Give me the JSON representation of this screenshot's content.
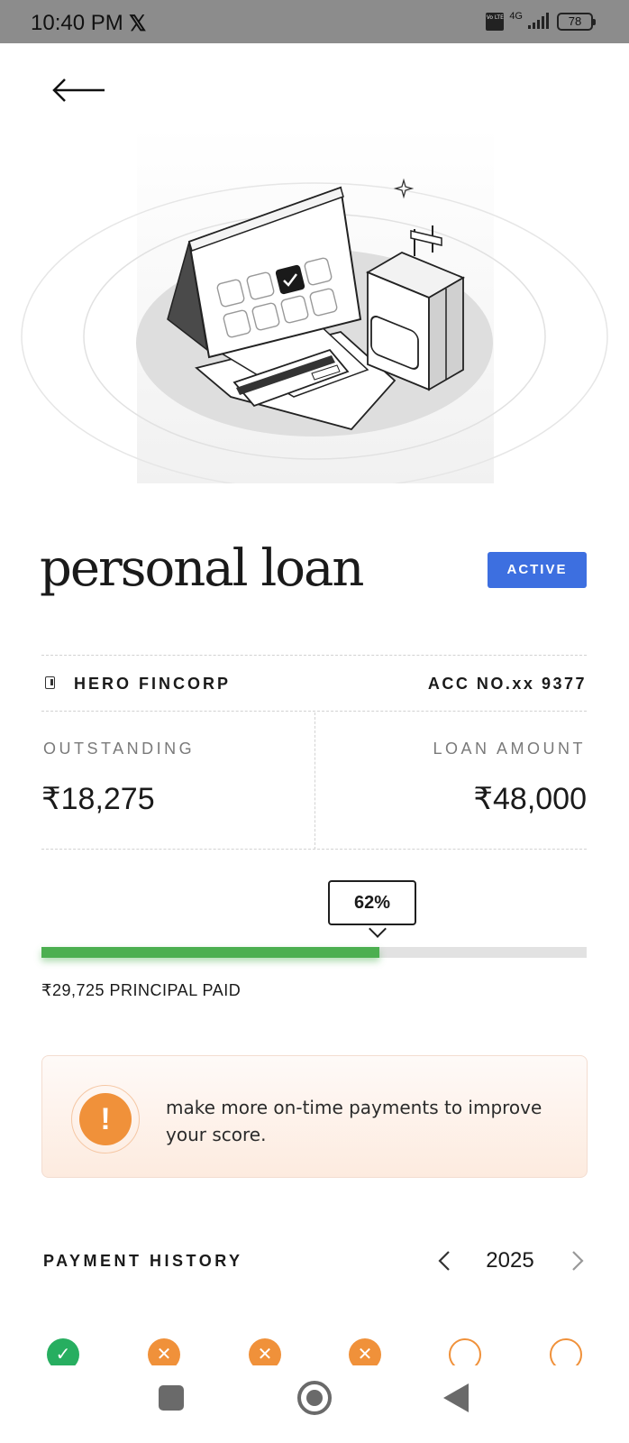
{
  "status_bar": {
    "time": "10:40 PM",
    "x_logo": "𝕏",
    "volte": "Vo LTE",
    "network": "4G",
    "battery": "78"
  },
  "loan": {
    "title": "personal loan",
    "status": "ACTIVE",
    "lender": "HERO FINCORP",
    "account": "ACC NO.xx 9377",
    "outstanding_label": "OUTSTANDING",
    "outstanding_value": "₹18,275",
    "loan_amount_label": "LOAN AMOUNT",
    "loan_amount_value": "₹48,000",
    "progress_label": "62%",
    "progress_fraction": 0.62,
    "principal_paid": "₹29,725 PRINCIPAL PAID"
  },
  "tip": {
    "icon": "!",
    "text": "make more on-time payments to improve your score."
  },
  "payment_history": {
    "title": "PAYMENT HISTORY",
    "year": "2025",
    "months": [
      {
        "status": "paid",
        "glyph": "✓"
      },
      {
        "status": "missed",
        "glyph": "✕"
      },
      {
        "status": "missed",
        "glyph": "✕"
      },
      {
        "status": "missed",
        "glyph": "✕"
      },
      {
        "status": "pending",
        "glyph": ""
      },
      {
        "status": "pending",
        "glyph": ""
      }
    ]
  },
  "colors": {
    "active_badge": "#3d6fe0",
    "progress": "#4caf50",
    "warning": "#f0913a",
    "paid": "#27ae60"
  },
  "icons": {
    "back": "left-arrow-icon",
    "lender": "lender-card-icon",
    "tip": "exclamation-icon",
    "year_prev": "chevron-left-icon",
    "year_next": "chevron-right-icon"
  }
}
